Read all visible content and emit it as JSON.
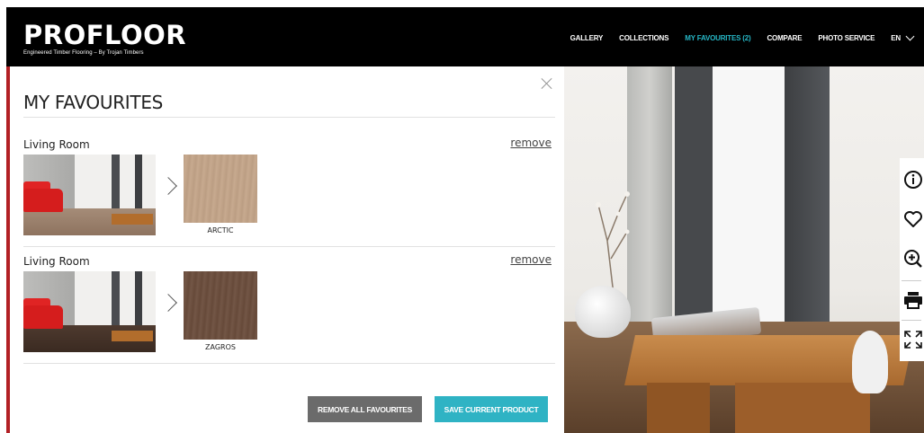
{
  "brand": {
    "name": "PROFLOOR",
    "tagline": "Engineered Timber Flooring – By Trojan Timbers"
  },
  "nav": {
    "items": [
      {
        "label": "GALLERY",
        "active": false
      },
      {
        "label": "COLLECTIONS",
        "active": false
      },
      {
        "label": "MY FAVOURITES (2)",
        "active": true
      },
      {
        "label": "COMPARE",
        "active": false
      },
      {
        "label": "PHOTO SERVICE",
        "active": false
      }
    ],
    "language": "EN",
    "accent_color": "#26b7c6"
  },
  "modal": {
    "title": "MY FAVOURITES",
    "favourites": [
      {
        "room": "Living Room",
        "remove_label": "remove",
        "product": "ARCTIC",
        "swatch_color": "#c4a589"
      },
      {
        "room": "Living Room",
        "remove_label": "remove",
        "product": "ZAGROS",
        "swatch_color": "#6b4d3c"
      }
    ],
    "buttons": {
      "remove_all": "REMOVE ALL FAVOURITES",
      "save_current": "SAVE CURRENT PRODUCT"
    }
  },
  "tools": [
    "info-icon",
    "heart-icon",
    "zoom-in-icon",
    "print-icon",
    "fullscreen-icon"
  ]
}
